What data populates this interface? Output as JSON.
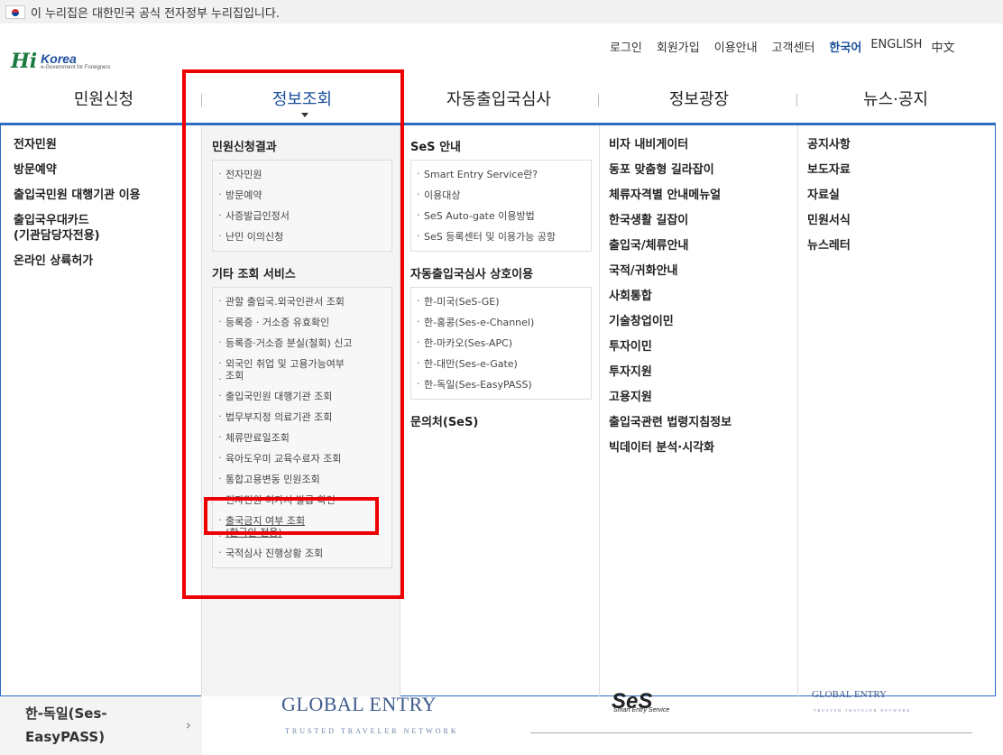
{
  "banner": {
    "text": "이 누리집은 대한민국 공식 전자정부 누리집입니다."
  },
  "logo": {
    "mark": "Hi",
    "brand": "Korea",
    "sub": "e-Government for Foreigners"
  },
  "util_nav": {
    "login": "로그인",
    "signup": "회원가입",
    "guide": "이용안내",
    "support": "고객센터",
    "lang_ko": "한국어",
    "lang_en": "ENGLISH",
    "lang_zh": "中文"
  },
  "gnb": {
    "items": [
      "민원신청",
      "정보조회",
      "자동출입국심사",
      "정보광장",
      "뉴스·공지"
    ]
  },
  "col1": {
    "links": [
      "전자민원",
      "방문예약",
      "출입국민원 대행기관 이용",
      "출입국우대카드",
      "(기관담당자전용)",
      "온라인 상륙허가"
    ]
  },
  "col2": {
    "group1_title": "민원신청결과",
    "group1_items": [
      "전자민원",
      "방문예약",
      "사증발급인정서",
      "난민 이의신청"
    ],
    "group2_title": "기타 조회 서비스",
    "group2_items": [
      "관할 출입국.외국인관서 조회",
      "등록증 · 거소증 유효확인",
      "등록증·거소증 분실(철회) 신고",
      "외국인 취업 및 고용가능여부",
      "조회",
      "출입국민원 대행기관 조회",
      "법무부지정 의료기관 조회",
      "체류만료일조회",
      "육아도우미 교육수료자 조회",
      "통합고용변동 민원조회",
      "전자민원 허가서 발급 확인",
      "출국금지 여부 조회",
      "(한국인 전용)",
      "국적심사 진행상황 조회"
    ]
  },
  "col3": {
    "group1_title": "SeS 안내",
    "group1_items": [
      "Smart Entry Service란?",
      "이용대상",
      "SeS Auto-gate 이용방법",
      "SeS 등록센터 및 이용가능 공항"
    ],
    "group2_title": "자동출입국심사 상호이용",
    "group2_items": [
      "한-미국(SeS-GE)",
      "한-홍콩(Ses-e-Channel)",
      "한-마카오(Ses-APC)",
      "한-대만(Ses-e-Gate)",
      "한-독일(Ses-EasyPASS)"
    ],
    "group3_title": "문의처(SeS)"
  },
  "col4": {
    "links": [
      "비자 내비게이터",
      "동포 맞춤형 길라잡이",
      "체류자격별 안내메뉴얼",
      "한국생활 길잡이",
      "출입국/체류안내",
      "국적/귀화안내",
      "사회통합",
      "기술창업이민",
      "투자이민",
      "투자지원",
      "고용지원",
      "출입국관련 법령지침정보",
      "빅데이터 분석·시각화"
    ]
  },
  "col5": {
    "links": [
      "공지사항",
      "보도자료",
      "자료실",
      "민원서식",
      "뉴스레터"
    ]
  },
  "under": {
    "left_line1": "한-독일(Ses-",
    "left_line2": "EasyPASS)",
    "ge_title": "GLOBAL ENTRY",
    "ge_sub": "TRUSTED TRAVELER NETWORK",
    "ses_logo": "SeS",
    "ses_sub": "Smart Entry Service",
    "ge_small": "GLOBAL ENTRY",
    "ge_small_sub": "TRUSTED TRAVELER NETWORK"
  },
  "colors": {
    "accent": "#2b6cc4",
    "annotation": "#e00000",
    "brand_blue": "#1b4f9b"
  }
}
